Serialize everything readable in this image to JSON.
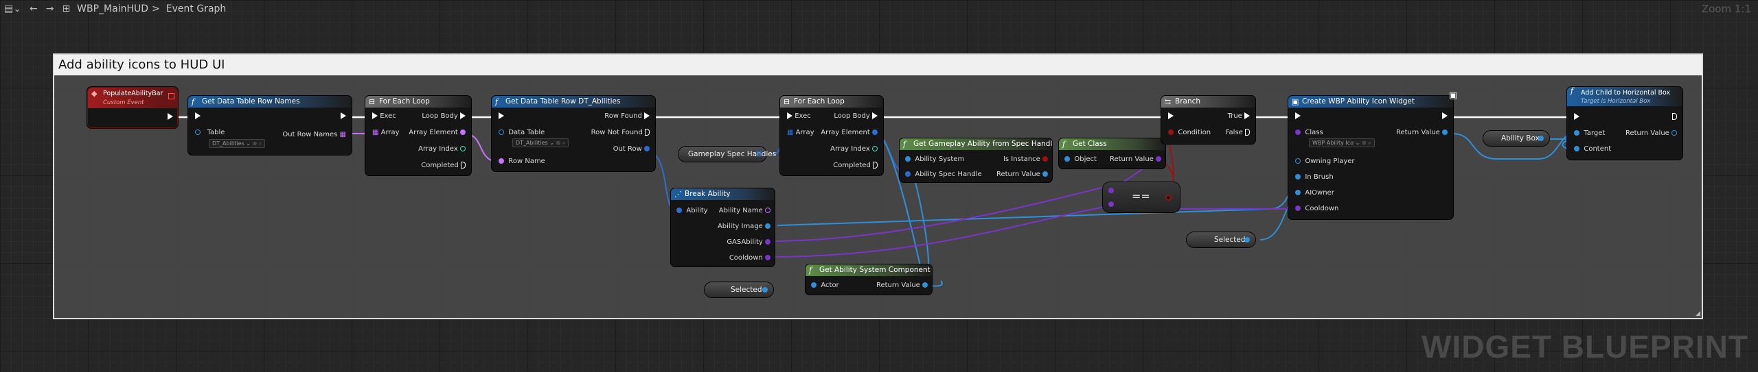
{
  "topbar": {
    "breadcrumb_root": "WBP_MainHUD",
    "breadcrumb_sep": ">",
    "breadcrumb_graph": "Event Graph",
    "zoom": "Zoom 1:1"
  },
  "comment": {
    "title": "Add ability icons to HUD UI"
  },
  "watermark": "WIDGET BLUEPRINT",
  "nodes": {
    "populate": {
      "title": "PopulateAbilityBar",
      "subtitle": "Custom Event"
    },
    "get_row_names": {
      "title": "Get Data Table Row Names",
      "table_label": "Table",
      "table_value": "DT_Abilities",
      "out_row_names": "Out Row Names"
    },
    "for_each_1": {
      "title": "For Each Loop",
      "exec": "Exec",
      "loop_body": "Loop Body",
      "array": "Array",
      "array_element": "Array Element",
      "array_index": "Array Index",
      "completed": "Completed"
    },
    "get_row": {
      "title": "Get Data Table Row DT_Abilities",
      "row_found": "Row Found",
      "row_not_found": "Row Not Found",
      "data_table": "Data Table",
      "data_table_value": "DT_Abilities",
      "out_row": "Out Row",
      "row_name": "Row Name"
    },
    "gameplay_spec": {
      "label": "Gameplay Spec Handles"
    },
    "break_ability": {
      "title": "Break Ability",
      "ability": "Ability",
      "ability_name": "Ability Name",
      "ability_image": "Ability Image",
      "gas_ability": "GASAbility",
      "cooldown": "Cooldown"
    },
    "for_each_2": {
      "title": "For Each Loop",
      "exec": "Exec",
      "loop_body": "Loop Body",
      "array": "Array",
      "array_element": "Array Element",
      "array_index": "Array Index",
      "completed": "Completed"
    },
    "get_gameplay_ability": {
      "title": "Get Gameplay Ability from Spec Handle",
      "ability_system": "Ability System",
      "is_instance": "Is Instance",
      "ability_spec_handle": "Ability Spec Handle",
      "return_value": "Return Value"
    },
    "get_class": {
      "title": "Get Class",
      "object": "Object",
      "return_value": "Return Value"
    },
    "equals": {
      "label": "=="
    },
    "get_asc": {
      "title": "Get Ability System Component",
      "actor": "Actor",
      "return_value": "Return Value"
    },
    "selected_1": {
      "label": "Selected"
    },
    "selected_2": {
      "label": "Selected"
    },
    "branch": {
      "title": "Branch",
      "true": "True",
      "condition": "Condition",
      "false": "False"
    },
    "create_widget": {
      "title": "Create WBP Ability Icon Widget",
      "class": "Class",
      "class_value": "WBP Ability Ico",
      "return_value": "Return Value",
      "owning_player": "Owning Player",
      "in_brush": "In Brush",
      "ai_owner": "AIOwner",
      "cooldown": "Cooldown"
    },
    "ability_box": {
      "label": "Ability Box"
    },
    "add_child": {
      "title": "Add Child to Horizontal Box",
      "subtitle": "Target is Horizontal Box",
      "target": "Target",
      "return_value": "Return Value",
      "content": "Content"
    }
  },
  "colors": {
    "exec": "#ffffff",
    "object": "#2f8fd8",
    "struct": "#2b6ed0",
    "purple": "#7a35c8",
    "name": "#cc70ff",
    "int": "#3fe0c0",
    "bool": "#a01010",
    "event": "#a01d1d"
  }
}
